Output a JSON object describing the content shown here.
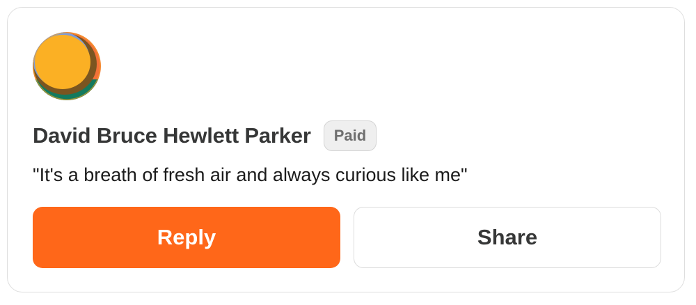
{
  "comment": {
    "author_name": "David Bruce Hewlett Parker",
    "badge_label": "Paid",
    "quote": "\"It's a breath of fresh air and always curious like me\"",
    "avatar_colors": {
      "rim": "#7e9bd8",
      "main": "#fbb024",
      "shadow": "#7a5520",
      "accent_orange": "#f27238",
      "bottom_green": "#137a5e"
    }
  },
  "actions": {
    "reply_label": "Reply",
    "share_label": "Share",
    "reply_color": "#ff6719"
  }
}
